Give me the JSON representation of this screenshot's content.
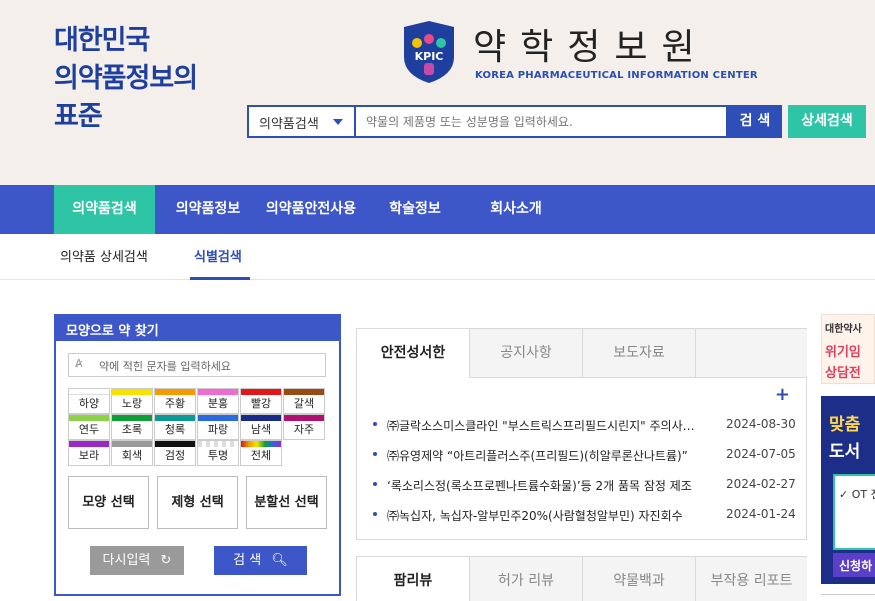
{
  "header": {
    "slogan": [
      "대한민국",
      "의약품정보의",
      "표준"
    ],
    "logo_badge_text": "KPIC",
    "logo_title": "약학정보원",
    "logo_subtitle": "KOREA PHARMACEUTICAL INFORMATION CENTER",
    "search_select": "의약품검색",
    "search_placeholder": "약물의 제품명 또는 성분명을 입력하세요.",
    "search_button": "검 색",
    "detail_button": "상세검색"
  },
  "nav": {
    "items": [
      "의약품검색",
      "의약품정보",
      "의약품안전사용",
      "학술정보",
      "회사소개"
    ],
    "active_index": 0
  },
  "subnav": {
    "items": [
      "의약품 상세검색",
      "식별검색"
    ],
    "active_index": 1
  },
  "shape_search": {
    "title": "모양으로 약 찾기",
    "input_placeholder": "약에 적힌 문자를 입력하세요",
    "colors": [
      {
        "label": "하양",
        "color": "#ffffff"
      },
      {
        "label": "노랑",
        "color": "#f5e400"
      },
      {
        "label": "주황",
        "color": "#f59a00"
      },
      {
        "label": "분홍",
        "color": "#f06ad0"
      },
      {
        "label": "빨강",
        "color": "#e21818"
      },
      {
        "label": "갈색",
        "color": "#9a4a12"
      },
      {
        "label": "연두",
        "color": "#8cd146"
      },
      {
        "label": "초록",
        "color": "#0d9e36"
      },
      {
        "label": "청록",
        "color": "#0a9a92"
      },
      {
        "label": "파랑",
        "color": "#2a6ae0"
      },
      {
        "label": "남색",
        "color": "#1a2a8a"
      },
      {
        "label": "자주",
        "color": "#b0106e"
      },
      {
        "label": "보라",
        "color": "#9a28c8"
      },
      {
        "label": "회색",
        "color": "#9a9a9a"
      },
      {
        "label": "검정",
        "color": "#111111"
      },
      {
        "label": "투명",
        "color": "checker"
      },
      {
        "label": "전체",
        "color": "rainbow"
      }
    ],
    "select_buttons": [
      "모양 선택",
      "제형 선택",
      "분할선 선택"
    ],
    "reset_button": "다시입력",
    "search_button": "검 색"
  },
  "notice": {
    "tabs": [
      "안전성서한",
      "공지사항",
      "보도자료"
    ],
    "active_index": 0,
    "more_label": "+",
    "items": [
      {
        "title": "㈜글락소스미스클라인 \"부스트릭스프리필드시린지\" 주의사항 변경",
        "date": "2024-08-30"
      },
      {
        "title": "㈜유영제약 “아트리플러스주(프리필드)(히알루론산나트륨)”",
        "date": "2024-07-05"
      },
      {
        "title": "‘록소리스정(록소프로펜나트륨수화물)’등 2개 품목 잠정 제조",
        "date": "2024-02-27"
      },
      {
        "title": "㈜녹십자, 녹십자-알부민주20%(사람혈청알부민) 자진회수",
        "date": "2024-01-24"
      }
    ]
  },
  "review": {
    "tabs": [
      "팜리뷰",
      "허가 리뷰",
      "약물백과",
      "부작용 리포트"
    ],
    "active_index": 0
  },
  "side_banners": {
    "banner1_top": "대한약사",
    "banner1_line1": "위기임",
    "banner1_line2": "상담전",
    "banner2_line1_hl": "맞춤",
    "banner2_line2": "도서",
    "banner2_box": "✓ OT 전 생",
    "banner2_foot": "신청하"
  }
}
